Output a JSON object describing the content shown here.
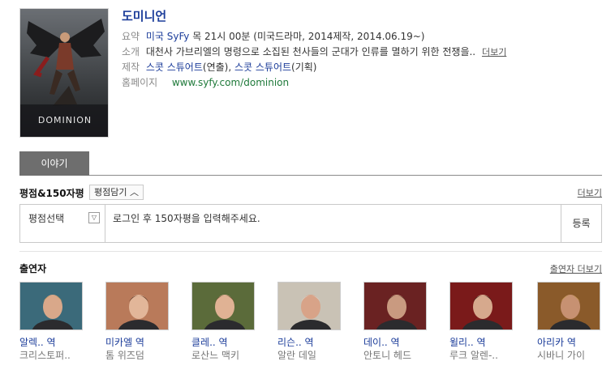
{
  "show": {
    "title": "도미니언",
    "poster_title": "DOMINION"
  },
  "info": {
    "summary_label": "요약",
    "summary_country_channel": "미국 SyFy",
    "summary_detail": "목 21시 00분 (미국드라마, 2014제작, 2014.06.19~)",
    "intro_label": "소개",
    "intro_text": "대천사 가브리엘의 명령으로 소집된 천사들의 군대가 인류를 멸하기 위한 전쟁을..",
    "intro_more": "더보기",
    "production_label": "제작",
    "production_1": "스콧 스튜어트",
    "production_1_role": "(연출)",
    "production_sep": ", ",
    "production_2": "스콧 스튜어트",
    "production_2_role": "(기획)",
    "homepage_label": "홈페이지",
    "homepage_url": "www.syfy.com/dominion"
  },
  "tabs": {
    "active": "이야기"
  },
  "rating": {
    "heading": "평점&150자평",
    "sort_button": "평점담기",
    "more": "더보기",
    "select_label": "평점선택",
    "dropdown_arrow": "▽",
    "prompt": "로그인 후 150자평을 입력해주세요.",
    "submit": "등록"
  },
  "cast_section": {
    "heading": "출연자",
    "more": "출연자 더보기",
    "members": [
      {
        "role": "알렉.. 역",
        "actor": "크리스토퍼..",
        "bg": "#3b6a7a",
        "skin": "#d9a88a",
        "hair": "#b8935a"
      },
      {
        "role": "미카엘 역",
        "actor": "톰 위즈덤",
        "bg": "#b97a5a",
        "skin": "#e2b699",
        "hair": "#4a2e1f"
      },
      {
        "role": "클레.. 역",
        "actor": "로산느 맥키",
        "bg": "#5b6b3a",
        "skin": "#e0b294",
        "hair": "#6b4a2c"
      },
      {
        "role": "리슨.. 역",
        "actor": "알란 데일",
        "bg": "#c9c2b5",
        "skin": "#d8a388",
        "hair": "#d9d4cc"
      },
      {
        "role": "데이.. 역",
        "actor": "안토니 헤드",
        "bg": "#6a2222",
        "skin": "#c99a80",
        "hair": "#5a3b2a"
      },
      {
        "role": "윌리.. 역",
        "actor": "루크 알렌-..",
        "bg": "#7a1a1a",
        "skin": "#d6a98d",
        "hair": "#2a1a12"
      },
      {
        "role": "아리카 역",
        "actor": "시바니 가이",
        "bg": "#8a5a2a",
        "skin": "#c79172",
        "hair": "#c49a4a"
      }
    ]
  }
}
